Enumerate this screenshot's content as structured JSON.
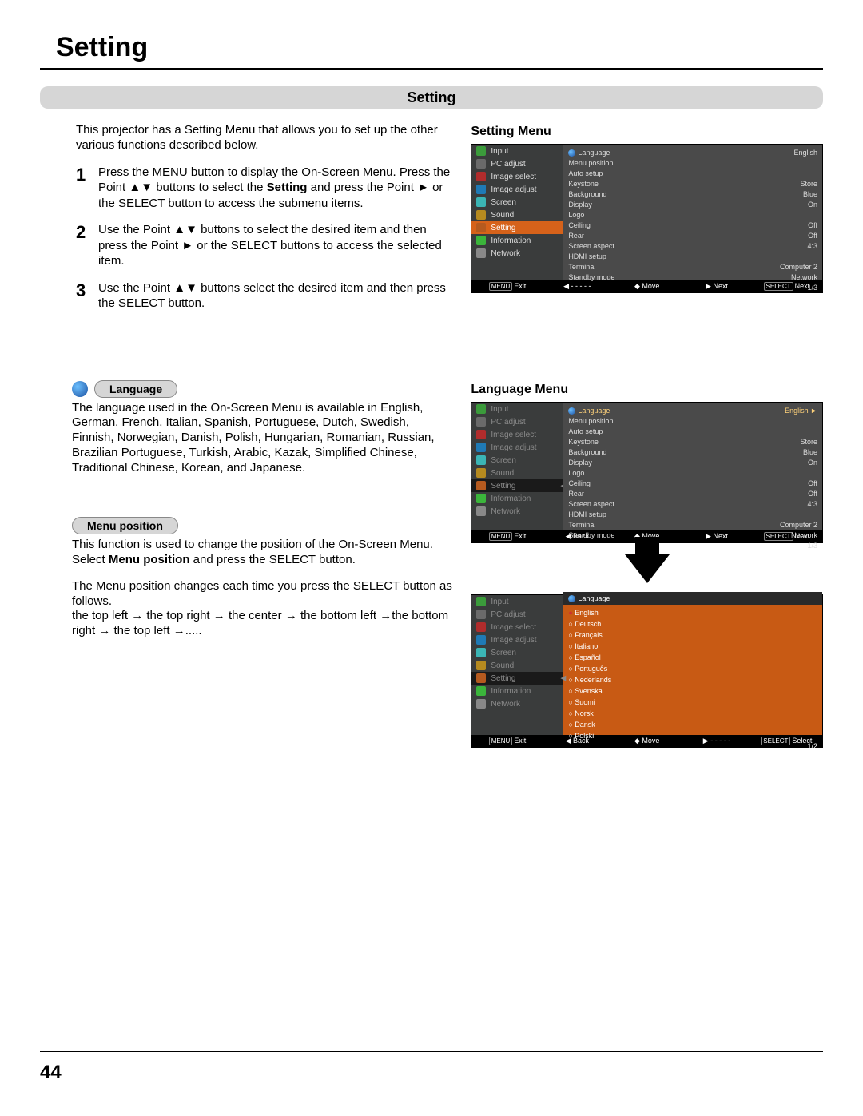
{
  "page_title": "Setting",
  "section_title": "Setting",
  "intro": "This projector has a Setting Menu that allows you to set up the other various functions described below.",
  "steps": [
    {
      "num": "1",
      "html": "Press the MENU button to display the On-Screen Menu. Press the Point ▲▼ buttons to select the <b>Setting</b> and press the Point ► or the SELECT button to access the submenu items."
    },
    {
      "num": "2",
      "html": "Use the Point ▲▼ buttons to select the desired item and then press the Point ► or the SELECT buttons to access the selected item."
    },
    {
      "num": "3",
      "html": "Use the Point ▲▼ buttons select the desired item and then press the SELECT button."
    }
  ],
  "language_heading": "Language",
  "language_body": "The language used in the On-Screen Menu is available in English, German, French, Italian, Spanish, Portuguese, Dutch, Swedish, Finnish, Norwegian, Danish, Polish, Hungarian, Romanian, Russian, Brazilian Portuguese, Turkish, Arabic, Kazak, Simplified Chinese, Traditional Chinese, Korean, and Japanese.",
  "menu_position_heading": "Menu position",
  "menu_position_body1": "This function is used to change the position of the On-Screen Menu. Select <b>Menu position</b> and press the SELECT button.",
  "menu_position_body2": "The Menu position changes each time you press the SELECT button as follows.",
  "menu_position_body3": "the top left  → the top right  → the center  → the bottom left →the bottom right  → the top left  →.....",
  "setting_menu_label": "Setting Menu",
  "language_menu_label": "Language Menu",
  "osd_left_items": [
    "Input",
    "PC adjust",
    "Image select",
    "Image adjust",
    "Screen",
    "Sound",
    "Setting",
    "Information",
    "Network"
  ],
  "osd_left_colors": [
    "#3b9b3b",
    "#6a6a6a",
    "#b02c2c",
    "#1f7ab5",
    "#3bb5b5",
    "#b58a1f",
    "#b55a1f",
    "#3bb53b",
    "#888"
  ],
  "osd_right_rows": [
    {
      "l": "Language",
      "r": "English",
      "icon": true
    },
    {
      "l": "Menu position",
      "r": ""
    },
    {
      "l": "Auto setup",
      "r": ""
    },
    {
      "l": "Keystone",
      "r": "Store"
    },
    {
      "l": "Background",
      "r": "Blue"
    },
    {
      "l": "Display",
      "r": "On"
    },
    {
      "l": "Logo",
      "r": ""
    },
    {
      "l": "Ceiling",
      "r": "Off"
    },
    {
      "l": "Rear",
      "r": "Off"
    },
    {
      "l": "Screen aspect",
      "r": "4:3"
    },
    {
      "l": "HDMI setup",
      "r": ""
    },
    {
      "l": "Terminal",
      "r": "Computer 2"
    },
    {
      "l": "Standby mode",
      "r": "Network"
    },
    {
      "l": "",
      "r": "1/3"
    }
  ],
  "bar1": {
    "exit": "Exit",
    "back": "- - - - -",
    "move": "Move",
    "next": "Next",
    "select": "Next",
    "k_exit": "MENU",
    "k_sel": "SELECT"
  },
  "bar2": {
    "exit": "Exit",
    "back": "Back",
    "move": "Move",
    "next": "Next",
    "select": "Next",
    "k_exit": "MENU",
    "k_sel": "SELECT"
  },
  "bar3": {
    "exit": "Exit",
    "back": "Back",
    "move": "Move",
    "next": "- - - - -",
    "select": "Select",
    "k_exit": "MENU",
    "k_sel": "SELECT"
  },
  "lang_list": [
    "English",
    "Deutsch",
    "Français",
    "Italiano",
    "Español",
    "Português",
    "Nederlands",
    "Svenska",
    "Suomi",
    "Norsk",
    "Dansk",
    "Polski"
  ],
  "lang_page": "1/2",
  "lang_hl_label": "Language",
  "lang_hl_value": "English",
  "page_number": "44"
}
